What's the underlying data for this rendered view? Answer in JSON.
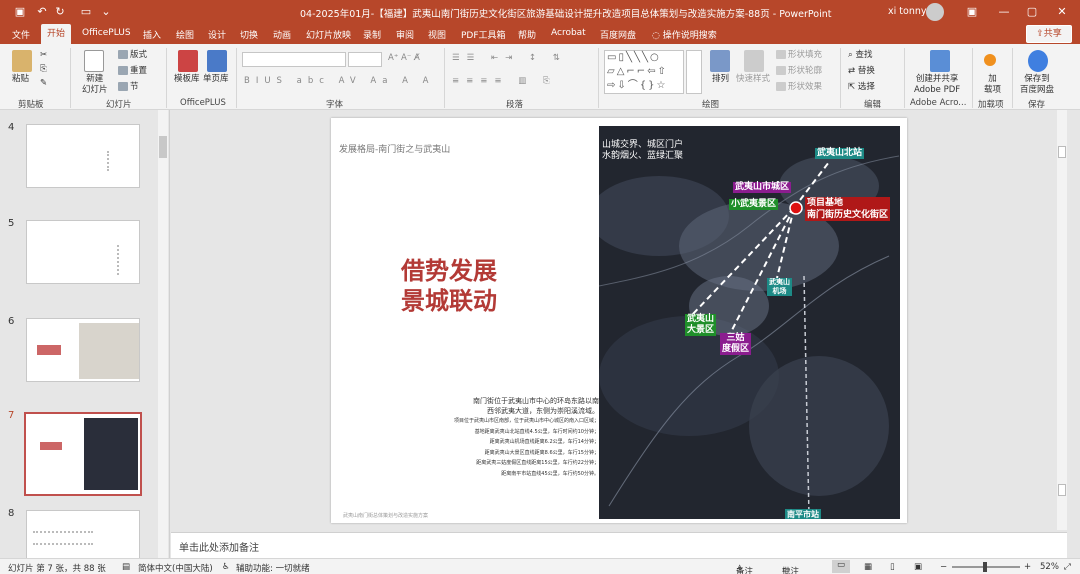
{
  "titlebar": {
    "doc_title": "04-2025年01月-【福建】武夷山南门街历史文化街区旅游基础设计提升改造项目总体策划与改造实施方案-88页 - PowerPoint",
    "user": "xi tonny"
  },
  "tabs": [
    "文件",
    "开始",
    "OfficePLUS",
    "插入",
    "绘图",
    "设计",
    "切换",
    "动画",
    "幻灯片放映",
    "录制",
    "审阅",
    "视图",
    "PDF工具箱",
    "帮助",
    "Acrobat",
    "百度网盘"
  ],
  "tell_me": "操作说明搜索",
  "share": "共享",
  "ribbon": {
    "paste": "粘贴",
    "clipboard": "剪贴板",
    "new_slide": "新建\n幻灯片",
    "layout": "版式",
    "reset": "重置",
    "section": "节",
    "slides": "幻灯片",
    "template_lib": "模板库",
    "single_lib": "单页库",
    "officeplus": "OfficePLUS",
    "font": "字体",
    "paragraph": "段落",
    "arrange": "排列",
    "quick_style": "快速样式",
    "shape_fill": "形状填充",
    "shape_outline": "形状轮廓",
    "shape_effect": "形状效果",
    "drawing": "绘图",
    "find": "查找",
    "replace": "替换",
    "select": "选择",
    "editing": "编辑",
    "create_pdf": "创建并共享\nAdobe PDF",
    "adobe_acro": "Adobe Acro...",
    "addins": "加\n载项",
    "addins_group": "加载项",
    "save_baidu": "保存到\n百度网盘",
    "save": "保存"
  },
  "thumbnails": [
    {
      "num": "4"
    },
    {
      "num": "5"
    },
    {
      "num": "6"
    },
    {
      "num": "7",
      "selected": true
    },
    {
      "num": "8"
    }
  ],
  "slide": {
    "heading": "发展格局-南门街之与武夷山",
    "big_title_1": "借势发展",
    "big_title_2": "景城联动",
    "desc_main_1": "南门街位于武夷山市中心的环岛东路以南",
    "desc_main_2": "西邻武夷大道，东侧为崇阳溪流域。",
    "desc_lines": [
      "项目位于武夷山市区南部，位于武夷山市中心城区的南入口区域；",
      "基地距离武夷山北站直线4.5公里，车行时间约10分钟；",
      "距离武夷山机场直线距离6.2公里，车行14分钟；",
      "距离武夷山大景区直线距离8.6公里，车行15分钟；",
      "距离武夷三姑度假区直线距离15公里，车行约22分钟；",
      "距离南平市站直线45公里，车行约50分钟。"
    ],
    "footer": "武夷山南门街总体策划与改造实施方案",
    "map": {
      "caption_1": "山城交界、城区门户",
      "caption_2": "水韵烟火、蓝绿汇聚",
      "labels": {
        "north_station": "武夷山北站",
        "city": "武夷山市城区",
        "xiaowuyi": "小武夷景区",
        "project_1": "项目基地",
        "project_2": "南门街历史文化街区",
        "airport": "武夷山\n机场",
        "scenic_1": "武夷山",
        "scenic_2": "大景区",
        "sangu_1": "三姑",
        "sangu_2": "度假区",
        "nanping": "南平市站"
      }
    }
  },
  "notes": "单击此处添加备注",
  "status": {
    "slide_info": "幻灯片 第 7 张，共 88 张",
    "language": "简体中文(中国大陆)",
    "accessibility": "辅助功能: 一切就绪",
    "notes_btn": "备注",
    "comments_btn": "批注",
    "zoom": "52%"
  },
  "colors": {
    "accent": "#b7472a",
    "title_red": "#b33a36",
    "tag_purple": "#8b1d8f",
    "tag_green": "#1f8f2a",
    "tag_teal": "#1d8a86",
    "tag_red": "#b01818"
  }
}
